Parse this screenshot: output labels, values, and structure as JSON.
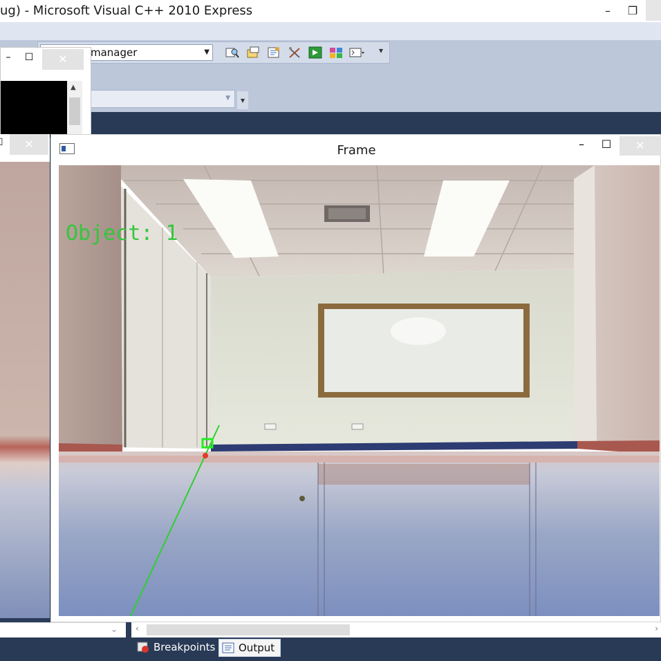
{
  "vs": {
    "title": "ug) - Microsoft Visual C++ 2010 Express",
    "minimize": "–",
    "maximize": "❐",
    "close": "",
    "config_combo_value": "manager",
    "overflow_glyph": "▾"
  },
  "console_window": {
    "minimize": "–",
    "maximize": "☐",
    "close": "✕"
  },
  "left_window": {
    "maximize": "☐",
    "close": "✕"
  },
  "frame_window": {
    "title": "Frame",
    "minimize": "–",
    "maximize": "☐",
    "close": "✕",
    "overlay_text": "Object: 1"
  },
  "bottom": {
    "tabs": [
      {
        "label": "Breakpoints",
        "icon": "breakpoints-icon",
        "active": false
      },
      {
        "label": "Output",
        "icon": "output-icon",
        "active": true
      }
    ]
  }
}
